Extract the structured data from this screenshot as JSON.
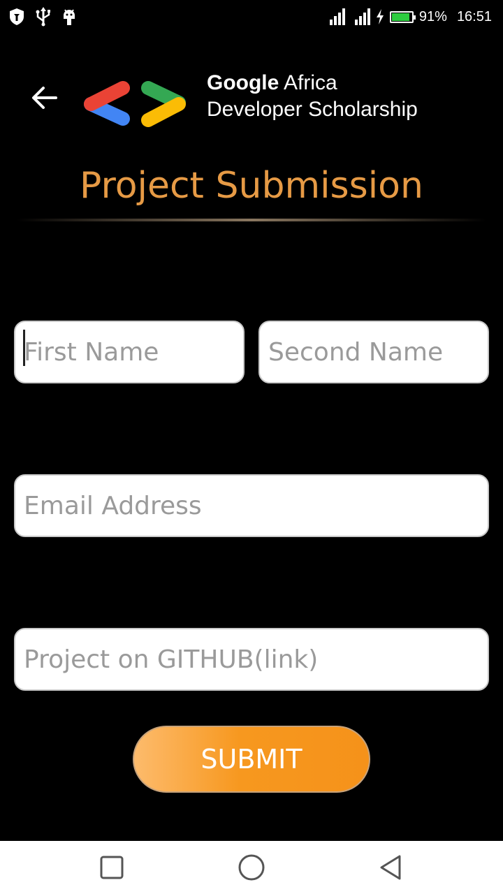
{
  "status_bar": {
    "battery": "91%",
    "battery_level": 0.91,
    "time": "16:51",
    "icons": [
      "shield-icon",
      "usb-icon",
      "android-debug-icon",
      "signal-icon",
      "signal-icon",
      "charging-icon",
      "battery-icon"
    ]
  },
  "header": {
    "brand_line1_bold": "Google",
    "brand_line1_rest": " Africa",
    "brand_line2": "Developer Scholarship",
    "title": "Project Submission"
  },
  "form": {
    "first_name_placeholder": "First Name",
    "second_name_placeholder": "Second Name",
    "email_placeholder": "Email Address",
    "github_placeholder": "Project on GITHUB(link)",
    "submit_label": "SUBMIT"
  },
  "colors": {
    "title": "#e69a45",
    "button": "#f7981f",
    "logo_red": "#ea4335",
    "logo_blue": "#4285f4",
    "logo_green": "#34a853",
    "logo_yellow": "#fbbc05"
  }
}
